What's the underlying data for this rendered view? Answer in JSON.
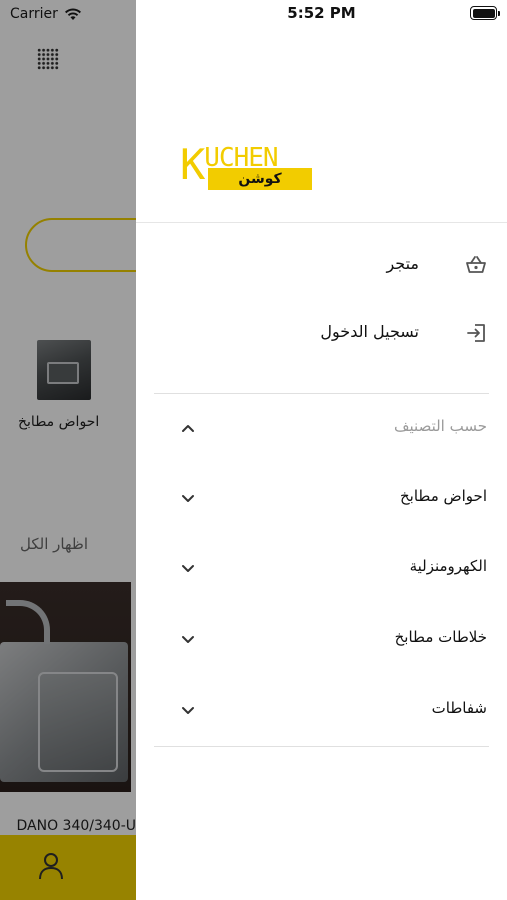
{
  "status": {
    "carrier": "Carrier",
    "time": "5:52 PM"
  },
  "background": {
    "category_label": "احواض مطابخ",
    "show_all_label": "اظهار الكل",
    "product_name": "DANO 340/340-U",
    "accent_color": "#f4d400"
  },
  "drawer": {
    "logo": {
      "latin": "KUCHEN",
      "arabic": "كوشن",
      "color": "#f2cc00"
    },
    "menu": [
      {
        "label": "متجر",
        "icon": "basket-icon"
      },
      {
        "label": "تسجيل الدخول",
        "icon": "login-icon"
      }
    ],
    "categories_header": {
      "label": "حسب التصنيف",
      "icon": "chevron-up-icon"
    },
    "categories": [
      {
        "label": "احواض مطابخ",
        "icon": "chevron-down-icon"
      },
      {
        "label": "الكهرومنزلية",
        "icon": "chevron-down-icon"
      },
      {
        "label": "خلاطات مطابخ",
        "icon": "chevron-down-icon"
      },
      {
        "label": "شفاطات",
        "icon": "chevron-down-icon"
      }
    ]
  }
}
